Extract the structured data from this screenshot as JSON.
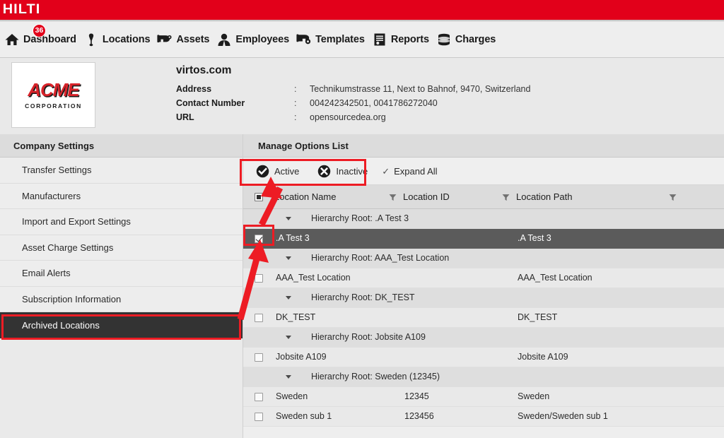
{
  "brand": {
    "name": "HILTI",
    "red": "#e2001a"
  },
  "nav": {
    "items": [
      {
        "label": "Dashboard",
        "icon": "home-icon",
        "badge": "36"
      },
      {
        "label": "Locations",
        "icon": "location-pin-icon",
        "badge": ""
      },
      {
        "label": "Assets",
        "icon": "power-tool-icon",
        "badge": ""
      },
      {
        "label": "Employees",
        "icon": "person-icon",
        "badge": ""
      },
      {
        "label": "Templates",
        "icon": "tool-gear-icon",
        "badge": ""
      },
      {
        "label": "Reports",
        "icon": "report-document-icon",
        "badge": ""
      },
      {
        "label": "Charges",
        "icon": "coins-stack-icon",
        "badge": ""
      }
    ]
  },
  "company": {
    "logo_text": "ACME",
    "logo_subtext": "CORPORATION",
    "title": "virtos.com",
    "fields": [
      {
        "label": "Address",
        "sep": ":",
        "value": "Technikumstrasse 11, Next to Bahnof, 9470, Switzerland"
      },
      {
        "label": "Contact Number",
        "sep": ":",
        "value": "004242342501, 0041786272040"
      },
      {
        "label": "URL",
        "sep": ":",
        "value": "opensourcedea.org"
      }
    ]
  },
  "sidebar": {
    "header": "Company Settings",
    "items": [
      {
        "label": "Transfer Settings",
        "active": false
      },
      {
        "label": "Manufacturers",
        "active": false
      },
      {
        "label": "Import and Export Settings",
        "active": false
      },
      {
        "label": "Asset Charge Settings",
        "active": false
      },
      {
        "label": "Email Alerts",
        "active": false
      },
      {
        "label": "Subscription Information",
        "active": false
      },
      {
        "label": "Archived Locations",
        "active": true
      }
    ]
  },
  "main": {
    "header": "Manage Options List",
    "toolbar": {
      "active_label": "Active",
      "inactive_label": "Inactive",
      "expand_all_label": "Expand All",
      "expand_all_checked": true
    },
    "table": {
      "columns": [
        {
          "label": "",
          "filter": false
        },
        {
          "label": "Location Name",
          "filter": true
        },
        {
          "label": "Location ID",
          "filter": true
        },
        {
          "label": "Location Path",
          "filter": true
        },
        {
          "label": "",
          "filter": true
        }
      ],
      "rows": [
        {
          "type": "group",
          "name": "Hierarchy Root: .A Test 3",
          "id": "",
          "path": "",
          "selected": false,
          "checked": false
        },
        {
          "type": "leaf",
          "name": ".A Test 3",
          "id": "",
          "path": ".A Test 3",
          "selected": true,
          "checked": true
        },
        {
          "type": "group",
          "name": "Hierarchy Root: AAA_Test Location",
          "id": "",
          "path": "",
          "selected": false,
          "checked": false
        },
        {
          "type": "leaf",
          "name": "AAA_Test Location",
          "id": "",
          "path": "AAA_Test Location",
          "selected": false,
          "checked": false
        },
        {
          "type": "group",
          "name": "Hierarchy Root: DK_TEST",
          "id": "",
          "path": "",
          "selected": false,
          "checked": false
        },
        {
          "type": "leaf",
          "name": "DK_TEST",
          "id": "",
          "path": "DK_TEST",
          "selected": false,
          "checked": false
        },
        {
          "type": "group",
          "name": "Hierarchy Root: Jobsite A109",
          "id": "",
          "path": "",
          "selected": false,
          "checked": false
        },
        {
          "type": "leaf",
          "name": "Jobsite A109",
          "id": "",
          "path": "Jobsite A109",
          "selected": false,
          "checked": false
        },
        {
          "type": "group",
          "name": "Hierarchy Root: Sweden (12345)",
          "id": "",
          "path": "",
          "selected": false,
          "checked": false
        },
        {
          "type": "leaf",
          "name": "Sweden",
          "id": "12345",
          "path": "Sweden",
          "selected": false,
          "checked": false
        },
        {
          "type": "leaf",
          "name": "Sweden sub 1",
          "id": "123456",
          "path": "Sweden/Sweden sub 1",
          "selected": false,
          "checked": false
        }
      ]
    }
  },
  "annotations": {
    "color": "#ed1c24",
    "highlights": [
      {
        "name": "active-inactive-highlight"
      },
      {
        "name": "row-checkbox-highlight"
      },
      {
        "name": "archived-locations-highlight"
      }
    ]
  }
}
